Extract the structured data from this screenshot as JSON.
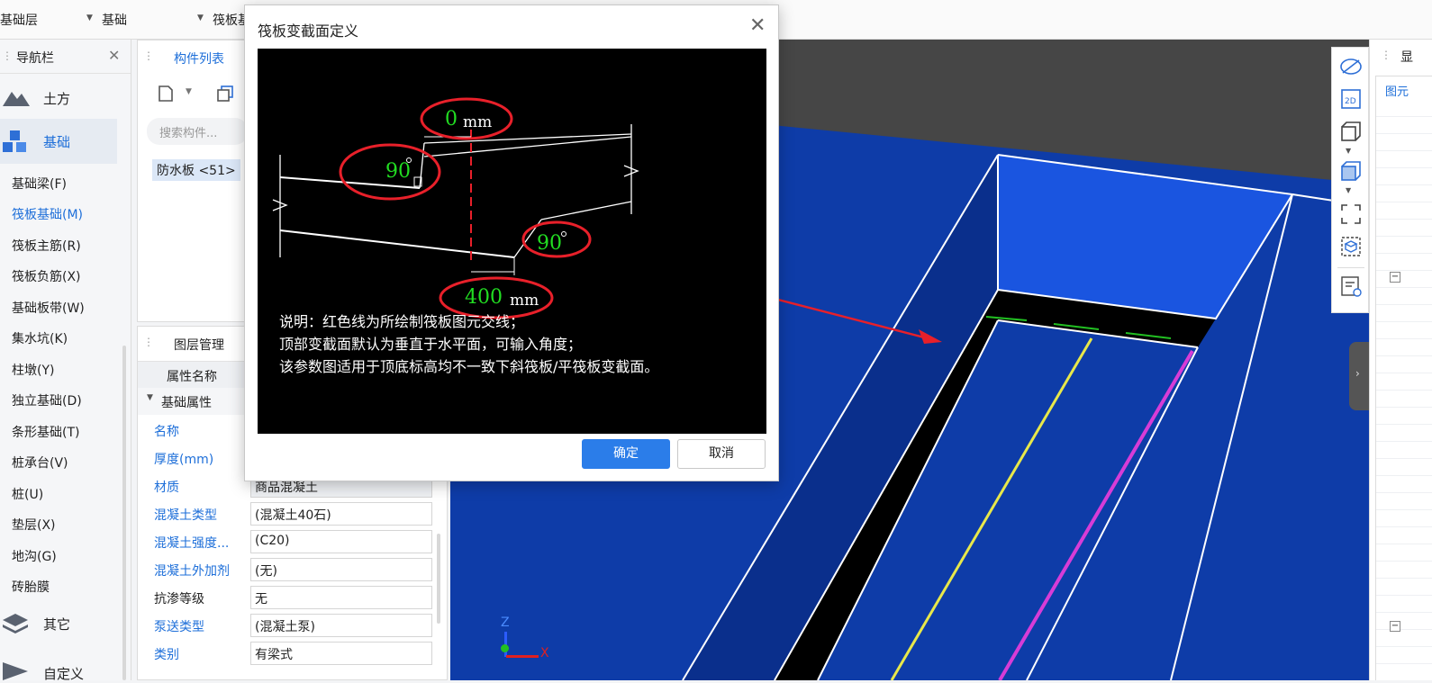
{
  "toolbar": {
    "floor_combo": "基础层",
    "category_combo": "基础",
    "type_combo": "筏板基"
  },
  "nav": {
    "title": "导航栏",
    "categories": [
      {
        "label": "土方"
      },
      {
        "label": "基础"
      },
      {
        "label": "其它"
      },
      {
        "label": "自定义"
      }
    ],
    "items": [
      "基础梁(F)",
      "筏板基础(M)",
      "筏板主筋(R)",
      "筏板负筋(X)",
      "基础板带(W)",
      "集水坑(K)",
      "柱墩(Y)",
      "独立基础(D)",
      "条形基础(T)",
      "桩承台(V)",
      "桩(U)",
      "垫层(X)",
      "地沟(G)",
      "砖胎膜"
    ]
  },
  "components": {
    "tab": "构件列表",
    "search_placeholder": "搜索构件...",
    "selected": "防水板 <51>"
  },
  "layers": {
    "tab": "图层管理",
    "col_name": "属性名称",
    "group": "基础属性",
    "rows": [
      {
        "name": "名称",
        "value": ""
      },
      {
        "name": "厚度(mm)",
        "value": ""
      },
      {
        "name": "材质",
        "value": "商品混凝土"
      },
      {
        "name": "混凝土类型",
        "value": "(混凝土40石)"
      },
      {
        "name": "混凝土强度...",
        "value": "(C20)"
      },
      {
        "name": "混凝土外加剂",
        "value": "(无)"
      },
      {
        "name": "抗渗等级",
        "value": "无"
      },
      {
        "name": "泵送类型",
        "value": "(混凝土泵)"
      },
      {
        "name": "类别",
        "value": "有梁式"
      }
    ]
  },
  "right_panel": {
    "title": "显",
    "tab": "图元"
  },
  "viewport": {
    "axis_z": "Z",
    "axis_x": "X"
  },
  "dialog": {
    "title": "筏板变截面定义",
    "diagram": {
      "top_value": "0",
      "top_unit": "mm",
      "left_angle": "90",
      "right_angle": "90",
      "bottom_value": "400",
      "bottom_unit": "mm",
      "note_line1": "说明：红色线为所绘制筏板图元交线；",
      "note_line2": "顶部变截面默认为垂直于水平面，可输入角度；",
      "note_line3": "该参数图适用于顶底标高均不一致下斜筏板/平筏板变截面。"
    },
    "ok_label": "确定",
    "cancel_label": "取消"
  }
}
